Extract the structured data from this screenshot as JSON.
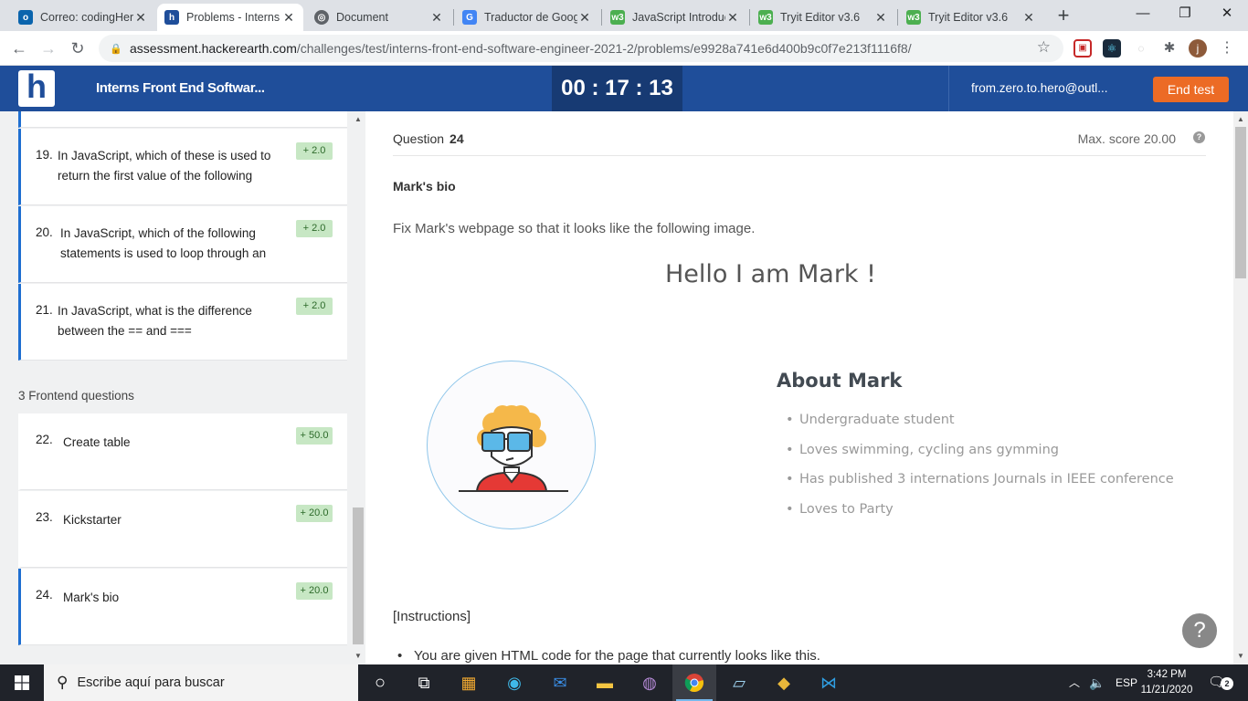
{
  "browser": {
    "tabs": [
      {
        "title": "Correo: codingHer",
        "icon": "outlook-icon"
      },
      {
        "title": "Problems - Interns",
        "icon": "hackerearth-icon"
      },
      {
        "title": "Document",
        "icon": "globe-icon"
      },
      {
        "title": "Traductor de Goog",
        "icon": "google-translate-icon"
      },
      {
        "title": "JavaScript Introduc",
        "icon": "w3schools-icon"
      },
      {
        "title": "Tryit Editor v3.6",
        "icon": "w3schools-icon"
      },
      {
        "title": "Tryit Editor v3.6",
        "icon": "w3schools-icon"
      }
    ],
    "url_host": "assessment.hackerearth.com",
    "url_path": "/challenges/test/interns-front-end-software-engineer-2021-2/problems/e9928a741e6d400b9c0f7e213f1116f8/",
    "profile_initial": "j"
  },
  "header": {
    "test_name": "Interns Front End Softwar...",
    "timer": "00 : 17 : 13",
    "user_email": "from.zero.to.hero@outl...",
    "end_test_label": "End test"
  },
  "sidebar": {
    "questions_before": [
      {
        "num": "19.",
        "text": "In JavaScript, which of these is used to return the first value of the following",
        "score": "+ 2.0"
      },
      {
        "num": "20.",
        "text": "In JavaScript, which of the following statements is used to loop through an",
        "score": "+ 2.0"
      },
      {
        "num": "21.",
        "text": "In JavaScript, what is the difference between the == and ===",
        "score": "+ 2.0"
      }
    ],
    "section_heading": "3 Frontend questions",
    "frontend_questions": [
      {
        "num": "22.",
        "text": "Create table",
        "score": "+ 50.0"
      },
      {
        "num": "23.",
        "text": "Kickstarter",
        "score": "+ 20.0"
      },
      {
        "num": "24.",
        "text": "Mark's bio",
        "score": "+ 20.0"
      }
    ]
  },
  "question": {
    "label": "Question",
    "number": "24",
    "max_score": "Max. score 20.00",
    "title": "Mark's bio",
    "description": "Fix Mark's webpage so that it looks like the following image.",
    "preview": {
      "heading": "Hello I am Mark !",
      "about_title": "About Mark",
      "bullets": [
        "Undergraduate student",
        "Loves swimming, cycling ans gymming",
        "Has published 3 internations Journals in IEEE conference",
        "Loves to Party"
      ]
    },
    "instructions_heading": "[Instructions]",
    "instructions_first": "You are given HTML code for the page that currently looks like this."
  },
  "taskbar": {
    "search_placeholder": "Escribe aquí para buscar",
    "language": "ESP",
    "time": "3:42 PM",
    "date": "11/21/2020",
    "notification_count": "2"
  },
  "colors": {
    "header_blue": "#1f4e9a",
    "end_test_orange": "#ec6b25",
    "score_badge_green": "#c7e7c4"
  }
}
